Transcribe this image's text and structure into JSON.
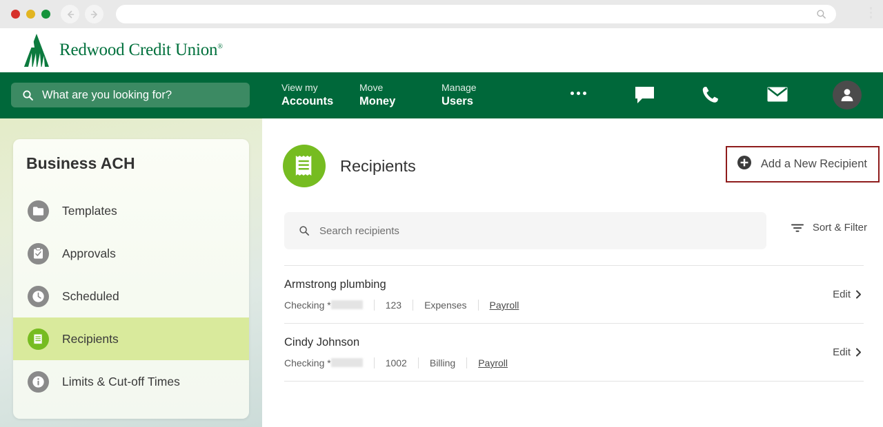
{
  "browser": {
    "traffic_lights": [
      "close",
      "minimize",
      "maximize"
    ],
    "back_icon": "back-arrow-icon",
    "forward_icon": "forward-arrow-icon",
    "url_value": "",
    "url_search_icon": "search-icon",
    "menu_icon": "kebab-menu-icon"
  },
  "brand": {
    "name": "Redwood Credit Union",
    "trademark": "®",
    "logo_icon": "redwood-tree-logo-icon",
    "primary_green": "#00703c",
    "nav_green": "#00683a",
    "accent_green": "#76bc21",
    "highlight_red": "#8e1b1b"
  },
  "nav": {
    "search_placeholder": "What are you looking for?",
    "search_value": "",
    "search_icon": "search-icon",
    "links": [
      {
        "line1": "View my",
        "line2": "Accounts"
      },
      {
        "line1": "Move",
        "line2": "Money"
      },
      {
        "line1": "Manage",
        "line2": "Users"
      }
    ],
    "more_icon": "ellipsis-icon",
    "chat_icon": "chat-bubble-icon",
    "phone_icon": "phone-icon",
    "mail_icon": "envelope-icon",
    "profile_icon": "user-avatar-icon"
  },
  "sidebar": {
    "title": "Business ACH",
    "items": [
      {
        "label": "Templates",
        "icon": "folder-icon",
        "active": false
      },
      {
        "label": "Approvals",
        "icon": "clipboard-check-icon",
        "active": false
      },
      {
        "label": "Scheduled",
        "icon": "clock-icon",
        "active": false
      },
      {
        "label": "Recipients",
        "icon": "receipt-icon",
        "active": true
      },
      {
        "label": "Limits & Cut-off Times",
        "icon": "info-icon",
        "active": false
      }
    ]
  },
  "main": {
    "page_icon": "receipt-icon",
    "page_title": "Recipients",
    "add_button": {
      "label": "Add a New Recipient",
      "icon": "plus-circle-icon",
      "highlighted": true
    },
    "search": {
      "placeholder": "Search recipients",
      "value": "",
      "icon": "search-icon"
    },
    "sort_filter": {
      "label": "Sort & Filter",
      "icon": "filter-icon"
    },
    "edit_label": "Edit",
    "edit_icon": "chevron-right-icon",
    "recipients": [
      {
        "name": "Armstrong plumbing",
        "account_type": "Checking *",
        "account_redacted": true,
        "number": "123",
        "category": "Expenses",
        "tag": "Payroll"
      },
      {
        "name": "Cindy Johnson",
        "account_type": "Checking *",
        "account_redacted": true,
        "number": "1002",
        "category": "Billing",
        "tag": "Payroll"
      }
    ]
  }
}
